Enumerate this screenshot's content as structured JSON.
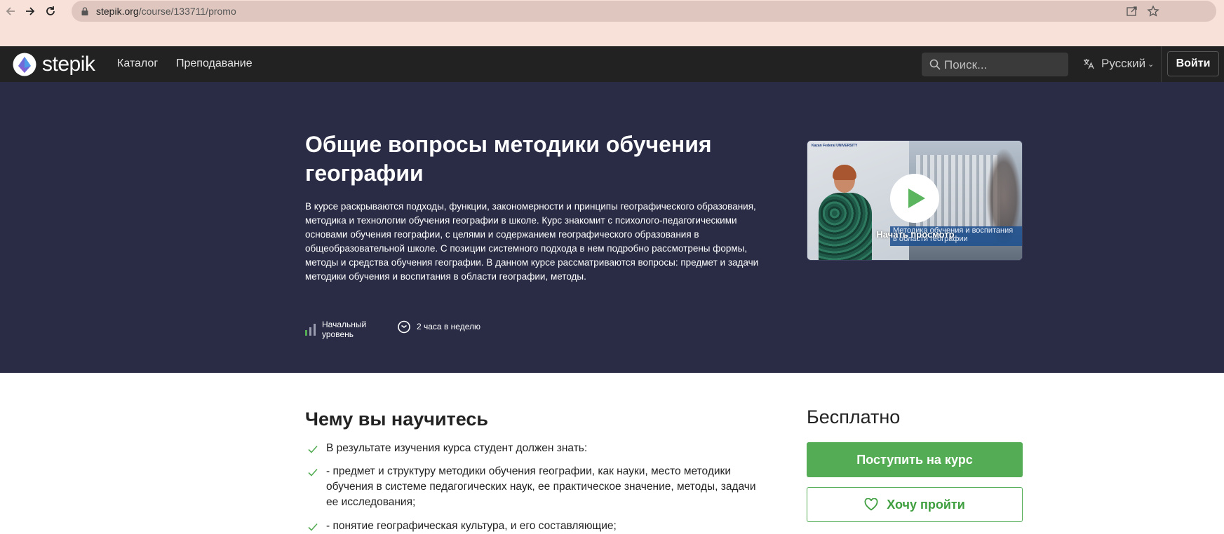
{
  "browser": {
    "url_domain": "stepik.org",
    "url_path": "/course/133711/promo"
  },
  "header": {
    "logo_text": "stepik",
    "nav": [
      "Каталог",
      "Преподавание"
    ],
    "search_placeholder": "Поиск...",
    "language": "Русский",
    "login_label": "Войти"
  },
  "hero": {
    "title": "Общие вопросы методики обучения географии",
    "description": "В курсе раскрываются подходы, функции, закономерности и принципы географического образования, методика и технологии обучения географии в школе. Курс знакомит с психолого-педагогическими основами обучения географии, с целями и содержанием географического образования в общеобразовательной школе. С позиции системного подхода в нем подробно рассмотрены формы, методы и средства обучения географии. В данном курсе рассматриваются вопросы: предмет и задачи методики обучения и воспитания в области географии, методы.",
    "level_line1": "Начальный",
    "level_line2": "уровень",
    "workload": "2 часа в неделю",
    "video": {
      "play_label": "Начать просмотр",
      "banner_line1": "Методика обучения и воспитания",
      "banner_line2": "в области географии",
      "univ_text": "Kazan Federal UNIVERSITY"
    }
  },
  "learn": {
    "title": "Чему вы научитесь",
    "items": [
      "В результате изучения курса студент должен знать:",
      "- предмет и структуру методики обучения географии, как науки, место методики обучения в системе педагогических наук, ее практическое значение, методы, задачи ее исследования;",
      "- понятие географическая культура, и его составляющие;"
    ]
  },
  "sidebar": {
    "price": "Бесплатно",
    "enroll_label": "Поступить на курс",
    "wishlist_label": "Хочу пройти"
  },
  "colors": {
    "header_bg": "#222222",
    "hero_bg": "#2a2c45",
    "accent_green": "#54ad54",
    "browser_bg": "#f7e1d9"
  }
}
